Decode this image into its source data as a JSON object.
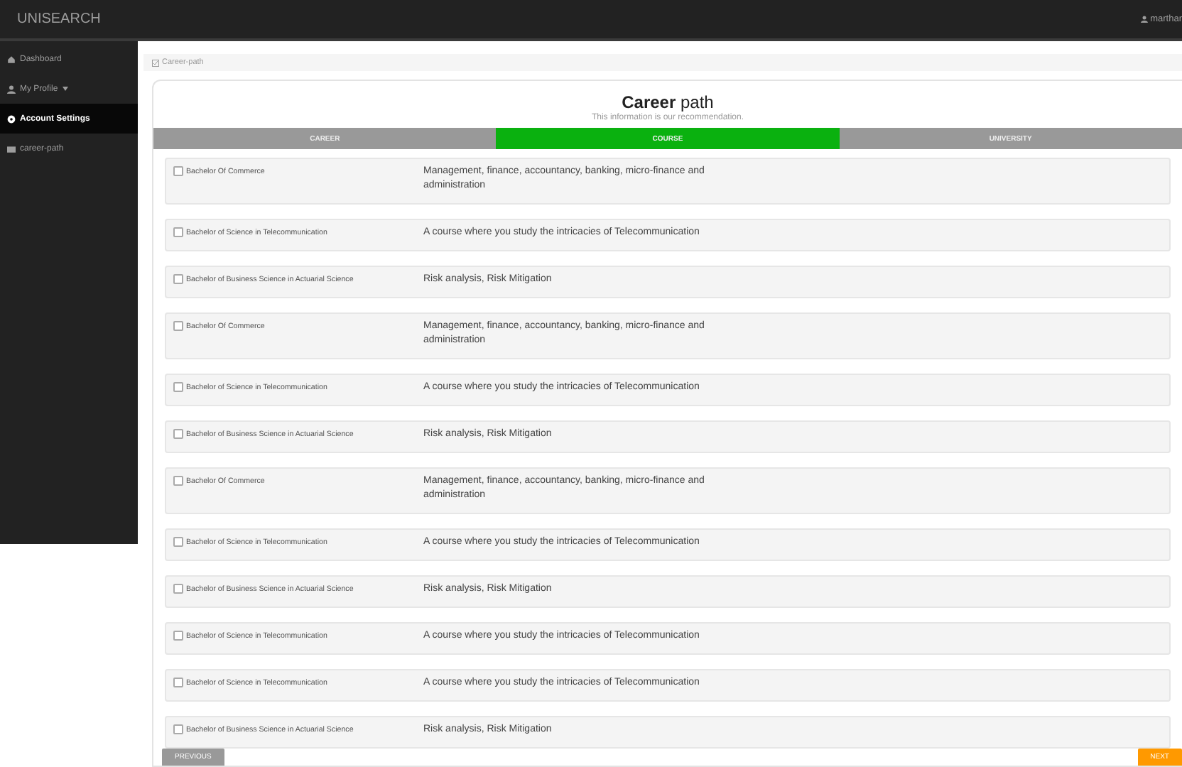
{
  "topbar": {
    "brand": "UNISEARCH",
    "user": "marthar"
  },
  "sidebar": {
    "items": [
      {
        "label": "Dashboard",
        "selected": false,
        "dropdown": false
      },
      {
        "label": "My Profile",
        "selected": false,
        "dropdown": true
      },
      {
        "label": "Account Settings",
        "selected": true,
        "dropdown": false
      },
      {
        "label": "career-path",
        "selected": false,
        "dropdown": false
      }
    ]
  },
  "breadcrumb": "Career-path",
  "card": {
    "title_bold": "Career",
    "title_rest": "path",
    "subtitle": "This information is our recommendation."
  },
  "steps": [
    {
      "label": "CAREER",
      "selected": false
    },
    {
      "label": "COURSE",
      "selected": true
    },
    {
      "label": "UNIVERSITY",
      "selected": false
    }
  ],
  "courses": [
    {
      "name": "Bachelor Of Commerce",
      "description": "Management, finance, accountancy, banking, micro-finance and administration",
      "checked": false
    },
    {
      "name": "Bachelor of Science in Telecommunication",
      "description": "A course where you study the intricacies of Telecommunication",
      "checked": false
    },
    {
      "name": "Bachelor of Business Science in Actuarial Science",
      "description": "Risk analysis, Risk Mitigation",
      "checked": false
    },
    {
      "name": "Bachelor Of Commerce",
      "description": "Management, finance, accountancy, banking, micro-finance and administration",
      "checked": false
    },
    {
      "name": "Bachelor of Science in Telecommunication",
      "description": "A course where you study the intricacies of Telecommunication",
      "checked": false
    },
    {
      "name": "Bachelor of Business Science in Actuarial Science",
      "description": "Risk analysis, Risk Mitigation",
      "checked": false
    },
    {
      "name": "Bachelor Of Commerce",
      "description": "Management, finance, accountancy, banking, micro-finance and administration",
      "checked": false
    },
    {
      "name": "Bachelor of Science in Telecommunication",
      "description": "A course where you study the intricacies of Telecommunication",
      "checked": false
    },
    {
      "name": "Bachelor of Business Science in Actuarial Science",
      "description": "Risk analysis, Risk Mitigation",
      "checked": false
    },
    {
      "name": "Bachelor of Science in Telecommunication",
      "description": "A course where you study the intricacies of Telecommunication",
      "checked": false
    },
    {
      "name": "Bachelor of Science in Telecommunication",
      "description": "A course where you study the intricacies of Telecommunication",
      "checked": false
    },
    {
      "name": "Bachelor of Business Science in Actuarial Science",
      "description": "Risk analysis, Risk Mitigation",
      "checked": false
    }
  ],
  "buttons": {
    "previous": "PREVIOUS",
    "next": "NEXT"
  }
}
